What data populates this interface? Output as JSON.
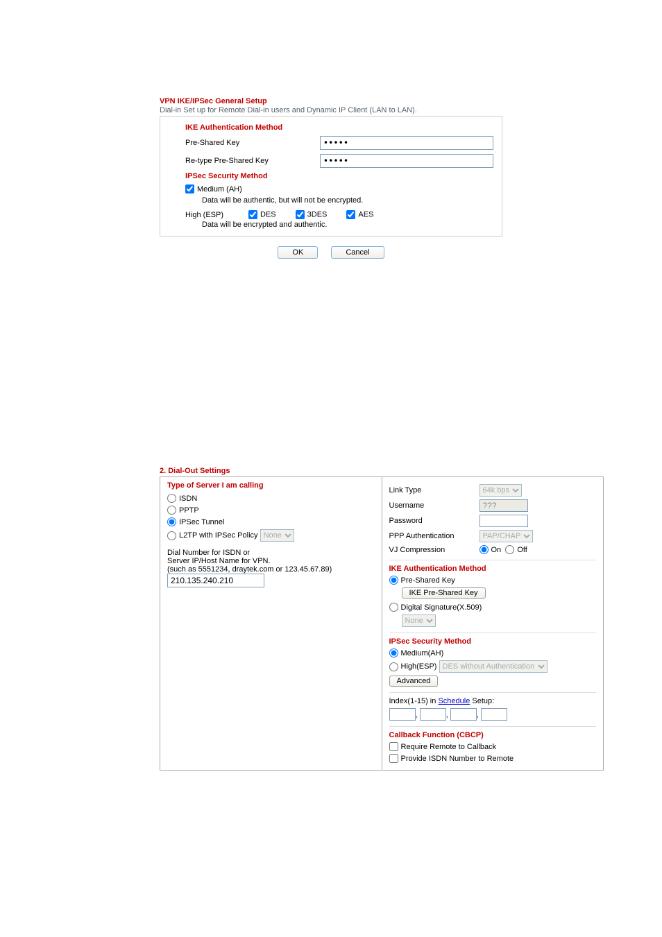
{
  "panel1": {
    "title": "VPN IKE/IPSec General Setup",
    "subtitle": "Dial-in Set up for Remote Dial-in users and Dynamic IP Client (LAN to LAN).",
    "ike_section": "IKE Authentication Method",
    "psk_label": "Pre-Shared Key",
    "psk_value": "•••••",
    "repsk_label": "Re-type Pre-Shared Key",
    "repsk_value": "•••••",
    "ipsec_section": "IPSec Security Method",
    "medium_label": "Medium (AH)",
    "medium_desc": "Data will be authentic, but will not be encrypted.",
    "high_label": "High (ESP)",
    "des_label": "DES",
    "des3_label": "3DES",
    "aes_label": "AES",
    "high_desc": "Data will be encrypted and authentic.",
    "ok": "OK",
    "cancel": "Cancel"
  },
  "panel2": {
    "title": "2. Dial-Out Settings",
    "left": {
      "head": "Type of Server I am calling",
      "isdn": "ISDN",
      "pptp": "PPTP",
      "ipsec": "IPSec Tunnel",
      "l2tp": "L2TP with IPSec Policy",
      "l2tp_sel": "None",
      "dial_label1": "Dial Number for ISDN or",
      "dial_label2": "Server IP/Host Name for VPN.",
      "dial_label3": "(such as 5551234, draytek.com or 123.45.67.89)",
      "dial_value": "210.135.240.210"
    },
    "right": {
      "linktype_label": "Link Type",
      "linktype_sel": "64k bps",
      "user_label": "Username",
      "user_val": "???",
      "pass_label": "Password",
      "pppauth_label": "PPP Authentication",
      "pppauth_sel": "PAP/CHAP",
      "vj_label": "VJ Compression",
      "on": "On",
      "off": "Off",
      "ike_head": "IKE Authentication Method",
      "psk": "Pre-Shared Key",
      "psk_btn": "IKE Pre-Shared Key",
      "digsig": "Digital Signature(X.509)",
      "digsig_sel": "None",
      "ipsec_head": "IPSec Security Method",
      "med": "Medium(AH)",
      "high": "High(ESP)",
      "high_sel": "DES without Authentication",
      "adv_btn": "Advanced",
      "sched_pre": "Index(1-15) in ",
      "sched_link": "Schedule",
      "sched_post": " Setup:",
      "cb_head": "Callback Function (CBCP)",
      "cb_req": "Require Remote to Callback",
      "cb_prov": "Provide ISDN Number to Remote"
    }
  }
}
